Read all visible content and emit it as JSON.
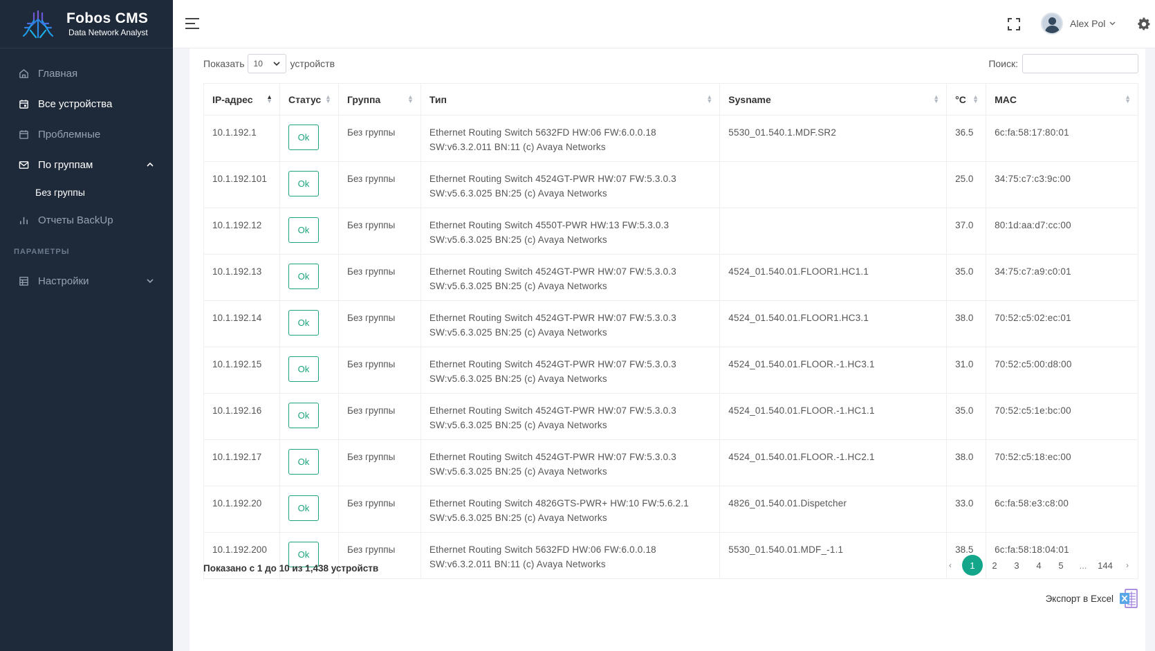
{
  "brand": {
    "title": "Fobos CMS",
    "subtitle": "Data Network Analyst"
  },
  "sidebar": {
    "items": [
      {
        "label": "Главная",
        "icon": "home-icon"
      },
      {
        "label": "Все устройства",
        "icon": "calendar-icon"
      },
      {
        "label": "Проблемные",
        "icon": "calendar-icon"
      },
      {
        "label": "По группам",
        "icon": "envelope-icon"
      }
    ],
    "sub_item": "Без группы",
    "backup_label": "Отчеты BackUp",
    "section_label": "ПАРАМЕТРЫ",
    "settings_label": "Настройки"
  },
  "header": {
    "user_name": "Alex Pol"
  },
  "controls": {
    "show_label": "Показать",
    "page_length": "10",
    "devices_label": "устройств",
    "search_label": "Поиск:",
    "search_value": ""
  },
  "table": {
    "headers": [
      "IP-адрес",
      "Статус",
      "Группа",
      "Тип",
      "Sysname",
      "°C",
      "MAC"
    ],
    "rows": [
      {
        "ip": "10.1.192.1",
        "status": "Ok",
        "group": "Без группы",
        "type1": "Ethernet Routing Switch 5632FD HW:06 FW:6.0.0.18",
        "type2": "SW:v6.3.2.011 BN:11 (c) Avaya Networks",
        "sysname": "5530_01.540.1.MDF.SR2",
        "temp": "36.5",
        "mac": "6c:fa:58:17:80:01"
      },
      {
        "ip": "10.1.192.101",
        "status": "Ok",
        "group": "Без группы",
        "type1": "Ethernet Routing Switch 4524GT-PWR HW:07 FW:5.3.0.3",
        "type2": "SW:v5.6.3.025 BN:25 (c) Avaya Networks",
        "sysname": "",
        "temp": "25.0",
        "mac": "34:75:c7:c3:9c:00"
      },
      {
        "ip": "10.1.192.12",
        "status": "Ok",
        "group": "Без группы",
        "type1": "Ethernet Routing Switch 4550T-PWR HW:13 FW:5.3.0.3",
        "type2": "SW:v5.6.3.025 BN:25 (c) Avaya Networks",
        "sysname": "",
        "temp": "37.0",
        "mac": "80:1d:aa:d7:cc:00"
      },
      {
        "ip": "10.1.192.13",
        "status": "Ok",
        "group": "Без группы",
        "type1": "Ethernet Routing Switch 4524GT-PWR HW:07 FW:5.3.0.3",
        "type2": "SW:v5.6.3.025 BN:25 (c) Avaya Networks",
        "sysname": "4524_01.540.01.FLOOR1.HC1.1",
        "temp": "35.0",
        "mac": "34:75:c7:a9:c0:01"
      },
      {
        "ip": "10.1.192.14",
        "status": "Ok",
        "group": "Без группы",
        "type1": "Ethernet Routing Switch 4524GT-PWR HW:07 FW:5.3.0.3",
        "type2": "SW:v5.6.3.025 BN:25 (c) Avaya Networks",
        "sysname": "4524_01.540.01.FLOOR1.HC3.1",
        "temp": "38.0",
        "mac": "70:52:c5:02:ec:01"
      },
      {
        "ip": "10.1.192.15",
        "status": "Ok",
        "group": "Без группы",
        "type1": "Ethernet Routing Switch 4524GT-PWR HW:07 FW:5.3.0.3",
        "type2": "SW:v5.6.3.025 BN:25 (c) Avaya Networks",
        "sysname": "4524_01.540.01.FLOOR.-1.HC3.1",
        "temp": "31.0",
        "mac": "70:52:c5:00:d8:00"
      },
      {
        "ip": "10.1.192.16",
        "status": "Ok",
        "group": "Без группы",
        "type1": "Ethernet Routing Switch 4524GT-PWR HW:07 FW:5.3.0.3",
        "type2": "SW:v5.6.3.025 BN:25 (c) Avaya Networks",
        "sysname": "4524_01.540.01.FLOOR.-1.HC1.1",
        "temp": "35.0",
        "mac": "70:52:c5:1e:bc:00"
      },
      {
        "ip": "10.1.192.17",
        "status": "Ok",
        "group": "Без группы",
        "type1": "Ethernet Routing Switch 4524GT-PWR HW:07 FW:5.3.0.3",
        "type2": "SW:v5.6.3.025 BN:25 (c) Avaya Networks",
        "sysname": "4524_01.540.01.FLOOR.-1.HC2.1",
        "temp": "38.0",
        "mac": "70:52:c5:18:ec:00"
      },
      {
        "ip": "10.1.192.20",
        "status": "Ok",
        "group": "Без группы",
        "type1": "Ethernet Routing Switch 4826GTS-PWR+ HW:10 FW:5.6.2.1",
        "type2": "SW:v5.6.3.025 BN:25 (c) Avaya Networks",
        "sysname": "4826_01.540.01.Dispetcher",
        "temp": "33.0",
        "mac": "6c:fa:58:e3:c8:00"
      },
      {
        "ip": "10.1.192.200",
        "status": "Ok",
        "group": "Без группы",
        "type1": "Ethernet Routing Switch 5632FD HW:06 FW:6.0.0.18",
        "type2": "SW:v6.3.2.011 BN:11 (c) Avaya Networks",
        "sysname": "5530_01.540.01.MDF_-1.1",
        "temp": "38.5",
        "mac": "6c:fa:58:18:04:01"
      }
    ]
  },
  "footer": {
    "info": "Показано с 1 до 10 из 1,438 устройств",
    "pages": [
      "1",
      "2",
      "3",
      "4",
      "5",
      "...",
      "144"
    ],
    "prev": "‹",
    "next": "›",
    "export_label": "Экспорт в Excel"
  },
  "colors": {
    "sidebar_bg": "#1e2a3a",
    "accent": "#13a68a",
    "ok_border": "#1aa37c",
    "temp_text": "#3b9a3b"
  }
}
